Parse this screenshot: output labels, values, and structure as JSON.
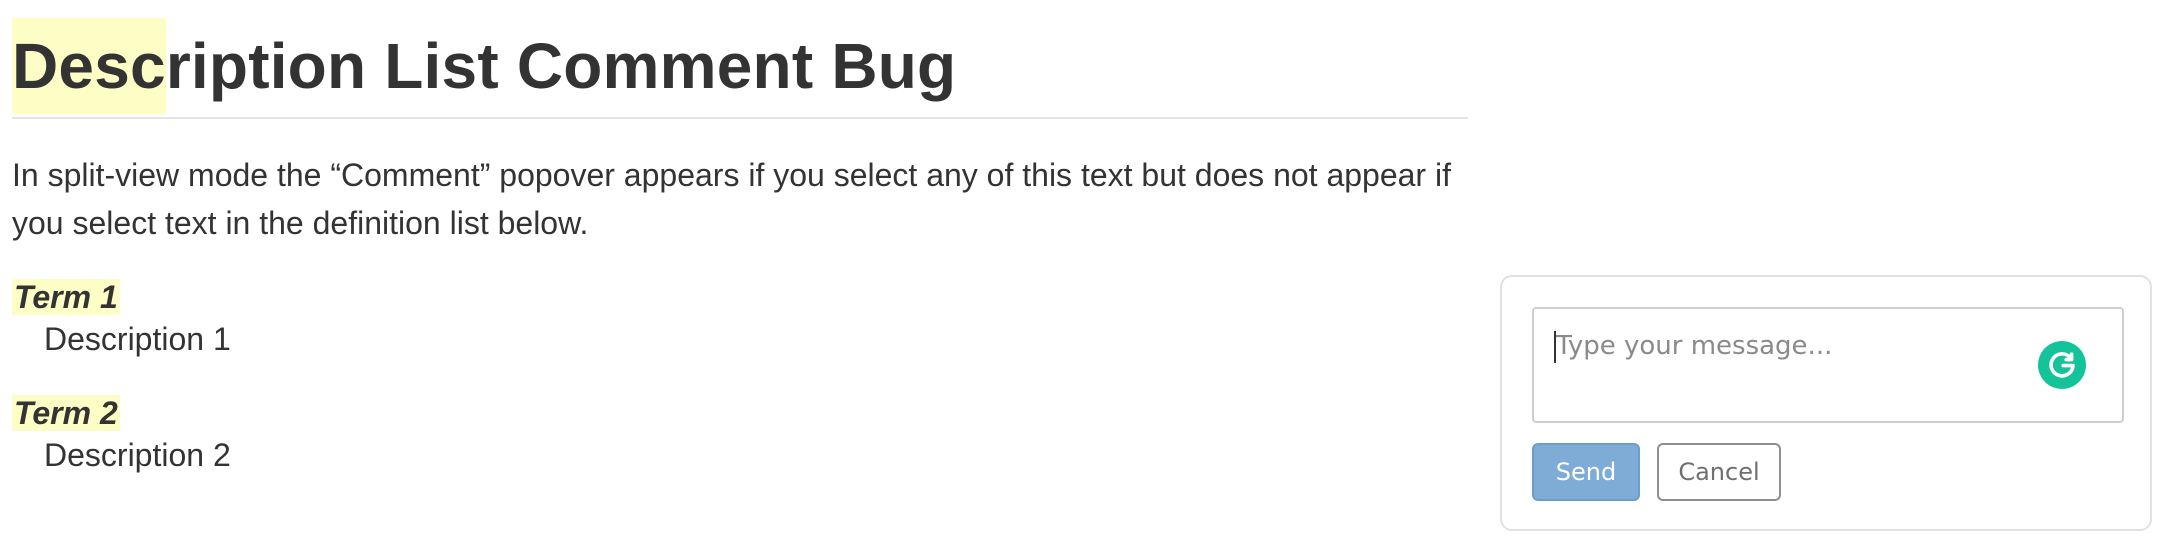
{
  "document": {
    "title_highlighted": "Desc",
    "title_rest": "ription List Comment Bug",
    "paragraph": "In split-view mode the “Comment” popover appears if you select any of this text but does not appear if you select text in the definition list below.",
    "definitions": [
      {
        "term": "Term 1",
        "description": "Description 1"
      },
      {
        "term": "Term 2",
        "description": "Description 2"
      }
    ]
  },
  "comment_popover": {
    "message_placeholder": "Type your message...",
    "send_label": "Send",
    "cancel_label": "Cancel",
    "assistant_icon": "grammarly-g-icon"
  },
  "colors": {
    "highlight": "#fdfdc6",
    "send_button": "#7facd6",
    "grammarly": "#15c39a",
    "text": "#333333"
  }
}
